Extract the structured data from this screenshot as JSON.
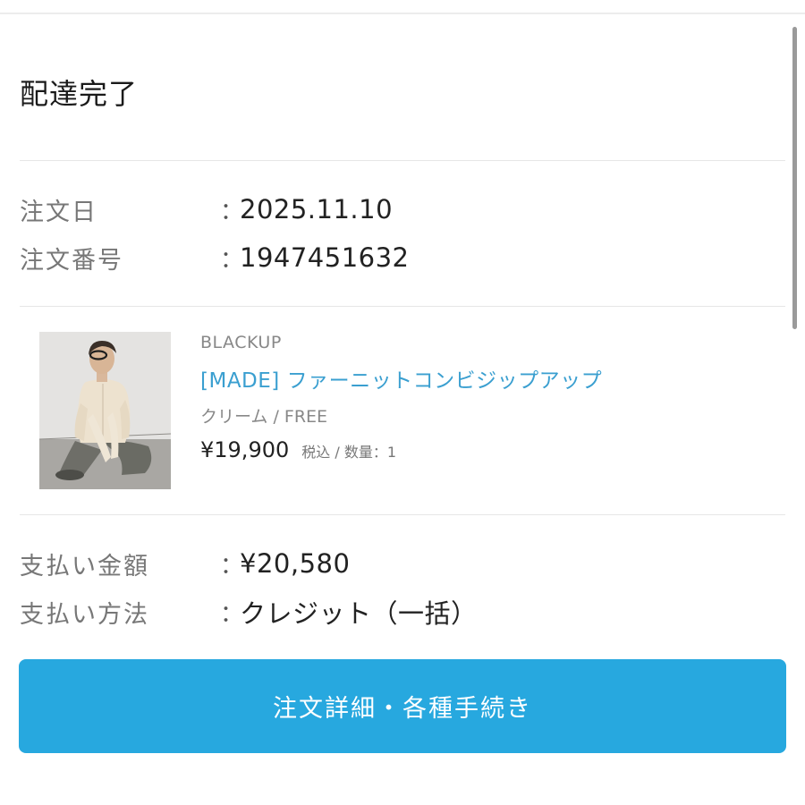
{
  "order_status": "配達完了",
  "order_info": {
    "order_date_label": "注文日",
    "order_date_value": "2025.11.10",
    "order_number_label": "注文番号",
    "order_number_value": "1947451632",
    "colon": "："
  },
  "product": {
    "brand": "BLACKUP",
    "name": "[MADE] ファーニットコンビジップアップ",
    "variant": "クリーム / FREE",
    "price": "¥19,900",
    "price_meta": "税込 / 数量：1",
    "image_icon": "product-photo"
  },
  "payment": {
    "amount_label": "支払い金額",
    "amount_value": "¥20,580",
    "method_label": "支払い方法",
    "method_value": "クレジット（一括）"
  },
  "actions": {
    "detail_button_label": "注文詳細・各種手続き"
  },
  "colors": {
    "accent": "#27a8df",
    "link": "#3a9fd0"
  }
}
